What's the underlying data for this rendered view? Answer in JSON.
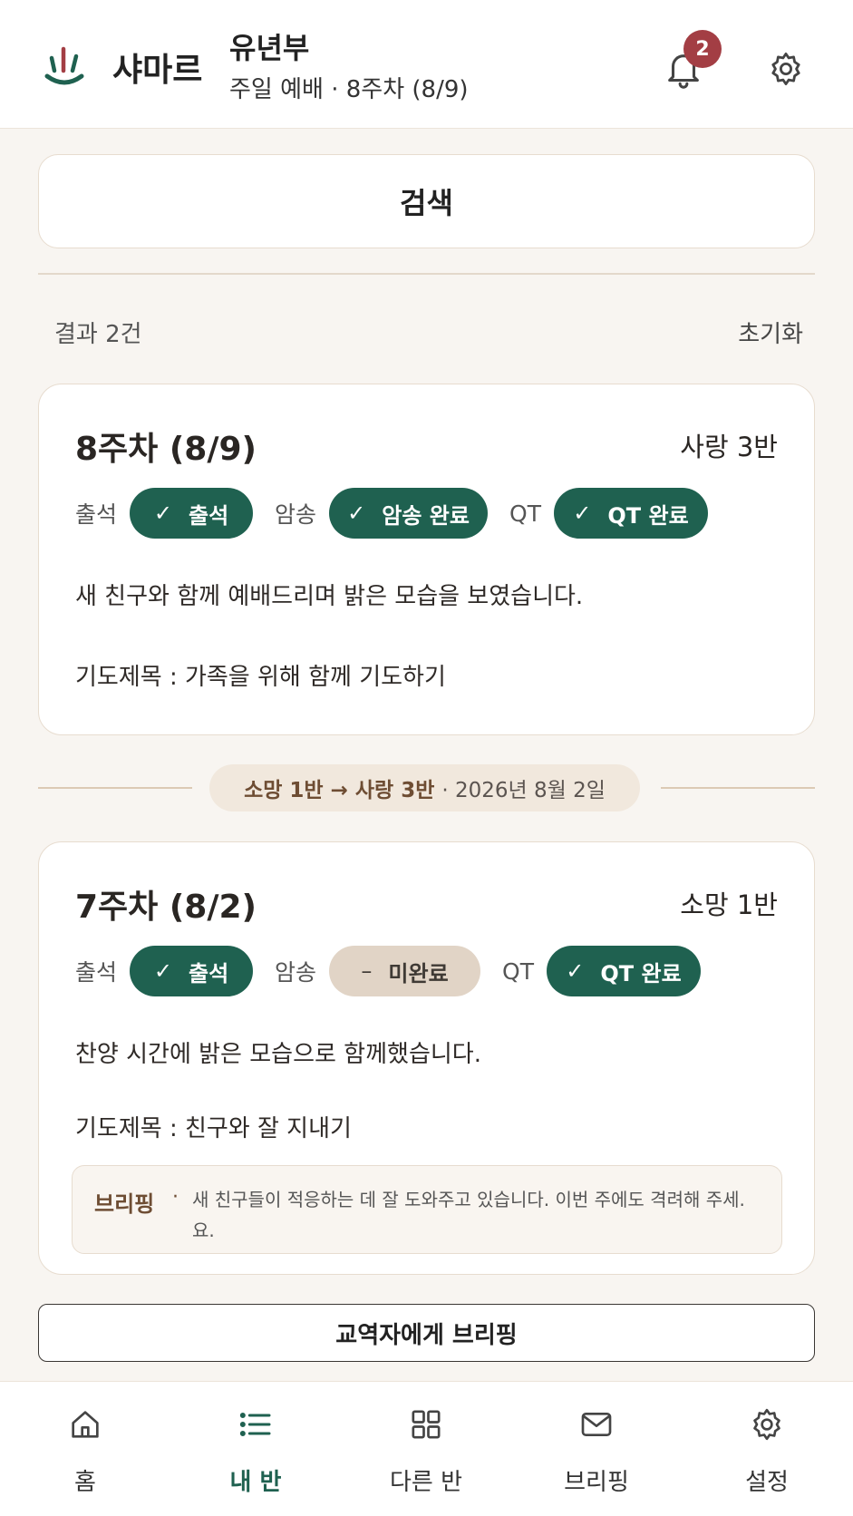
{
  "header": {
    "brand": "샤마르",
    "department": "유년부",
    "subtitle": "주일 예배 · 8주차 (8/9)",
    "notification_count": "2"
  },
  "search": {
    "button_label": "검색"
  },
  "results": {
    "count_label": "결과 2건",
    "reset_label": "초기화"
  },
  "labels": {
    "attendance": "출석",
    "memorize": "암송",
    "qt": "QT"
  },
  "records": [
    {
      "week": "8주차 (8/9)",
      "class": "사랑 3반",
      "attendance": {
        "label": "출석",
        "done": true
      },
      "memorize": {
        "label": "암송 완료",
        "done": true
      },
      "qt": {
        "label": "QT 완료",
        "done": true
      },
      "note": "새 친구와 함께 예배드리며 밝은 모습을 보였습니다.",
      "prayer": "기도제목 : 가족을 위해 함께 기도하기"
    },
    {
      "week": "7주차 (8/2)",
      "class": "소망 1반",
      "attendance": {
        "label": "출석",
        "done": true
      },
      "memorize": {
        "label": "미완료",
        "done": false
      },
      "qt": {
        "label": "QT 완료",
        "done": true
      },
      "note": "찬양 시간에 밝은 모습으로 함께했습니다.",
      "prayer": "기도제목 : 친구와 잘 지내기",
      "briefing": {
        "label": "브리핑",
        "text": "새 친구들이 적응하는 데 잘 도와주고 있습니다. 이번 주에도 격려해 주세. 요."
      }
    }
  ],
  "transfer": {
    "from_to": "소망 1반 → 사랑 3반",
    "date": "· 2026년 8월 2일"
  },
  "briefing_button": "교역자에게 브리핑",
  "nav": [
    {
      "label": "홈",
      "icon": "home-icon"
    },
    {
      "label": "내 반",
      "icon": "list-icon",
      "active": true
    },
    {
      "label": "다른 반",
      "icon": "grid-icon"
    },
    {
      "label": "브리핑",
      "icon": "mail-icon"
    },
    {
      "label": "설정",
      "icon": "gear-icon"
    }
  ],
  "colors": {
    "primary": "#1f6150",
    "badge": "#a33e44",
    "pending": "#e1d4c6",
    "accent_brown": "#6e4d33",
    "background": "#f8f5f1"
  }
}
